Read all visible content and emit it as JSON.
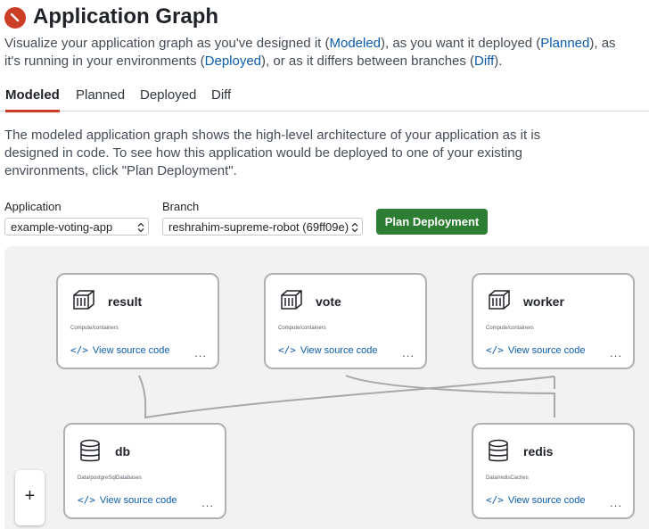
{
  "header": {
    "title": "Application Graph",
    "logo_icon": "radius-logo",
    "intro": {
      "t1": "Visualize your application graph as you've designed it (",
      "l1": "Modeled",
      "t2": "), as you want it deployed (",
      "l2": "Planned",
      "t3": "), as it's running in your environments (",
      "l3": "Deployed",
      "t4": "), or as it differs between branches (",
      "l4": "Diff",
      "t5": ")."
    }
  },
  "tabs": [
    "Modeled",
    "Planned",
    "Deployed",
    "Diff"
  ],
  "description": "The modeled application graph shows the high-level architecture of your application as it is designed in code. To see how this application would be deployed to one of your existing environments, click \"Plan Deployment\".",
  "form": {
    "application_label": "Application",
    "application_value": "example-voting-app",
    "branch_label": "Branch",
    "branch_value": "reshrahim-supreme-robot (69ff09e)",
    "plan_button": "Plan Deployment"
  },
  "nodes": [
    {
      "name": "result",
      "type": "Compute/containers",
      "icon": "container-icon",
      "link": "View source code",
      "code": "</>",
      "more": "..."
    },
    {
      "name": "vote",
      "type": "Compute/containers",
      "icon": "container-icon",
      "link": "View source code",
      "code": "</>",
      "more": "..."
    },
    {
      "name": "worker",
      "type": "Compute/containers",
      "icon": "container-icon",
      "link": "View source code",
      "code": "</>",
      "more": "..."
    },
    {
      "name": "db",
      "type": "Data/postgreSqlDatabases",
      "icon": "database-icon",
      "link": "View source code",
      "code": "</>",
      "more": "..."
    },
    {
      "name": "redis",
      "type": "Data/redisCaches",
      "icon": "database-icon",
      "link": "View source code",
      "code": "</>",
      "more": "..."
    }
  ],
  "controls": {
    "zoom_in": "+"
  },
  "colors": {
    "accent": "#cc3f27",
    "link": "#0b5cad",
    "primary_button": "#2d7d32"
  }
}
